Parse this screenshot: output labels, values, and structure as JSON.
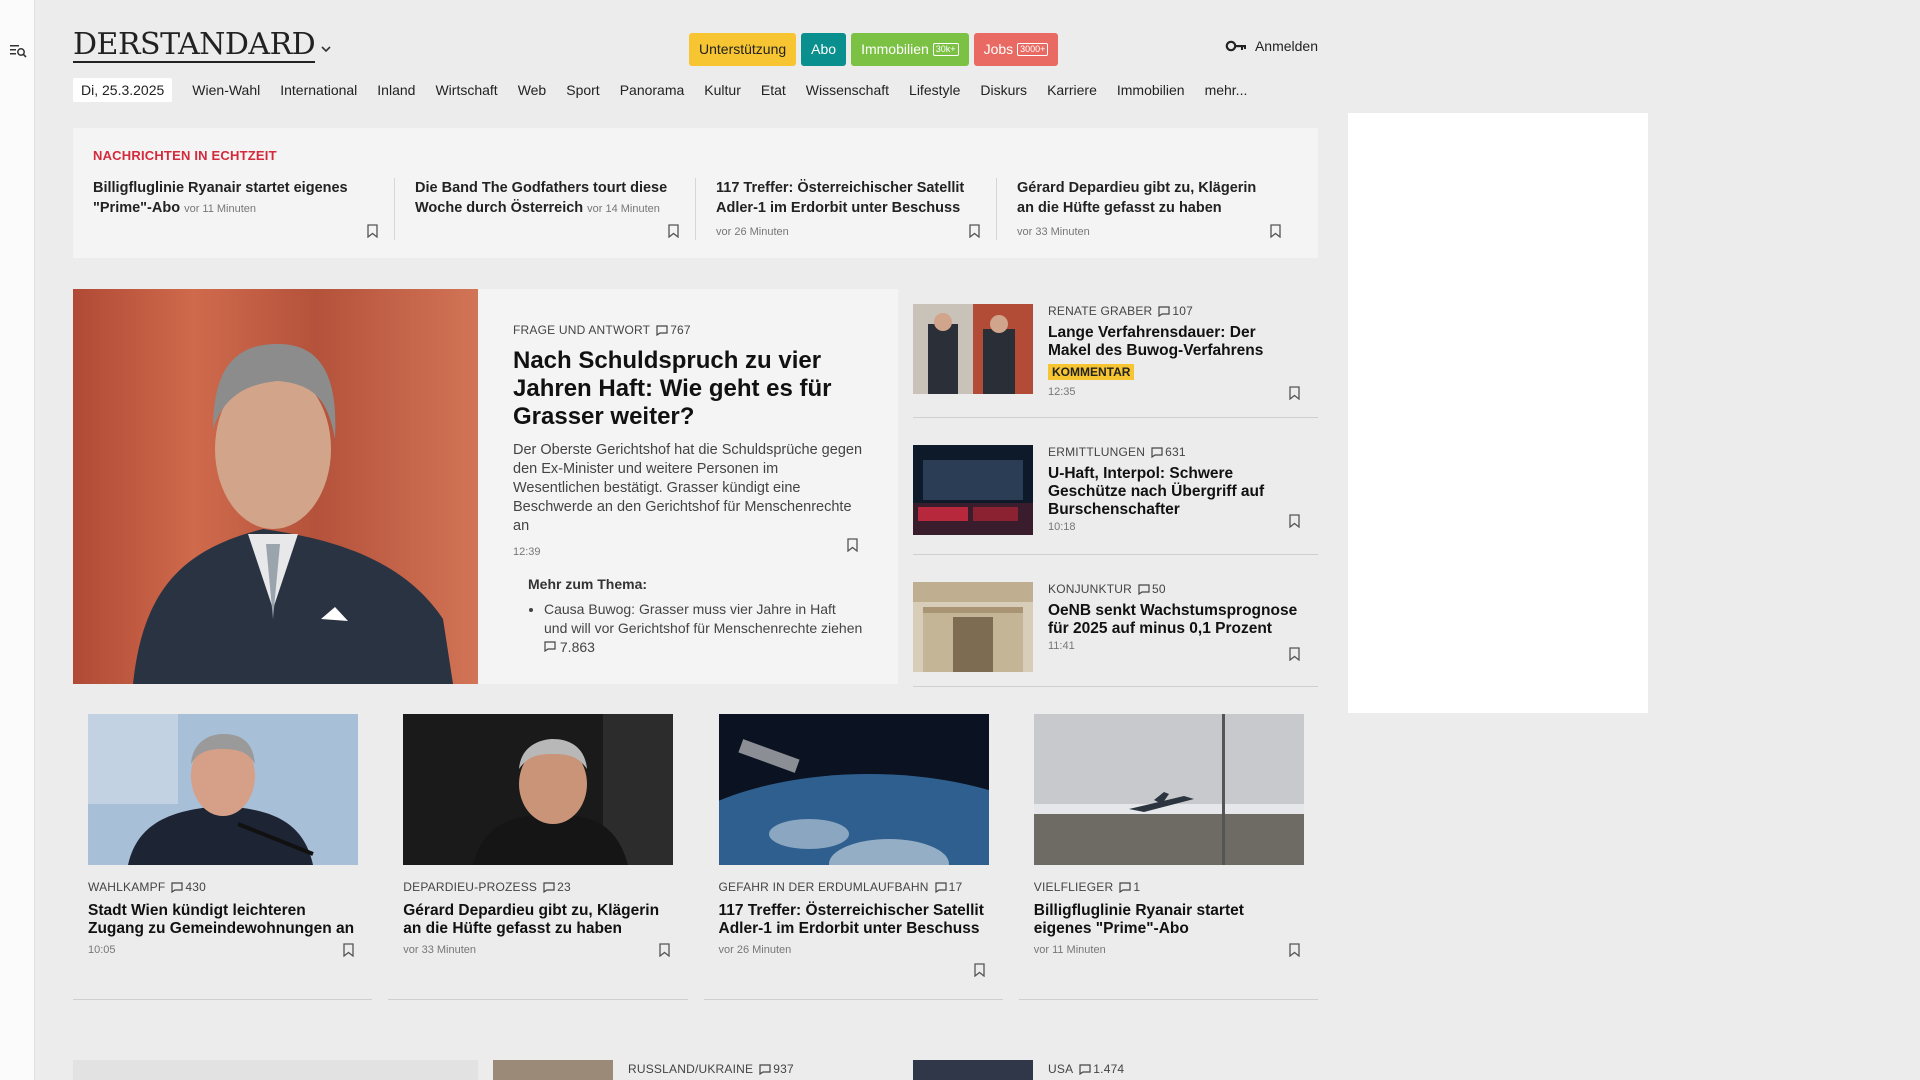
{
  "header": {
    "logo_text": "DERSTANDARD",
    "pills": [
      {
        "label": "Unterstützung",
        "tag": ""
      },
      {
        "label": "Abo",
        "tag": ""
      },
      {
        "label": "Immobilien",
        "tag": "30k+"
      },
      {
        "label": "Jobs",
        "tag": "3000+"
      }
    ],
    "login_label": "Anmelden"
  },
  "nav": {
    "date": "Di, 25.3.2025",
    "items": [
      "Wien-Wahl",
      "International",
      "Inland",
      "Wirtschaft",
      "Web",
      "Sport",
      "Panorama",
      "Kultur",
      "Etat",
      "Wissenschaft",
      "Lifestyle",
      "Diskurs",
      "Karriere",
      "Immobilien",
      "mehr..."
    ]
  },
  "live": {
    "heading": "NACHRICHTEN IN ECHTZEIT",
    "items": [
      {
        "title": "Billigfluglinie Ryanair startet eigenes \"Prime\"-Abo",
        "time": "vor 11 Minuten"
      },
      {
        "title": "Die Band The Godfathers tourt diese Woche durch Österreich",
        "time": "vor 14 Minuten"
      },
      {
        "title": "117 Treffer: Österreichischer Satellit Adler-1 im Erdorbit unter Beschuss",
        "time": "vor 26 Minuten"
      },
      {
        "title": "Gérard Depardieu gibt zu, Klägerin an die Hüfte gefasst zu haben",
        "time": "vor 33 Minuten"
      }
    ]
  },
  "lead": {
    "kicker": "FRAGE UND ANTWORT",
    "comments": "767",
    "title": "Nach Schuldspruch zu vier Jahren Haft: Wie geht es für Grasser weiter?",
    "teaser": "Der Oberste Gerichtshof hat die Schuldsprüche gegen den Ex-Minister und weitere Personen im Wesentlichen bestätigt. Grasser kündigt eine Beschwerde an den Gerichtshof für Menschenrechte an",
    "time": "12:39",
    "more_title": "Mehr zum Thema:",
    "more_item": "Causa Buwog: Grasser muss vier Jahre in Haft und will vor Gerichtshof für Menschenrechte ziehen",
    "more_comments": "7.863"
  },
  "side": [
    {
      "kicker": "RENATE GRABER",
      "comments": "107",
      "title": "Lange Verfahrensdauer: Der Makel des Buwog-Verfahrens",
      "badge": "KOMMENTAR",
      "time": "12:35"
    },
    {
      "kicker": "ERMITTLUNGEN",
      "comments": "631",
      "title": "U-Haft, Interpol: Schwere Geschütze nach Übergriff auf Burschenschafter",
      "badge": "",
      "time": "10:18"
    },
    {
      "kicker": "KONJUNKTUR",
      "comments": "50",
      "title": "OeNB senkt Wachstumsprognose für 2025 auf minus 0,1 Prozent",
      "badge": "",
      "time": "11:41"
    }
  ],
  "tiles": [
    {
      "kicker": "WAHLKAMPF",
      "comments": "430",
      "title": "Stadt Wien kündigt leichteren Zugang zu Gemeindewohnungen an",
      "time": "10:05"
    },
    {
      "kicker": "DEPARDIEU-PROZESS",
      "comments": "23",
      "title": "Gérard Depardieu gibt zu, Klägerin an die Hüfte gefasst zu haben",
      "time": "vor 33 Minuten"
    },
    {
      "kicker": "GEFAHR IN DER ERDUMLAUFBAHN",
      "comments": "17",
      "title": "117 Treffer: Österreichischer Satellit Adler-1 im Erdorbit unter Beschuss",
      "time": "vor 26 Minuten"
    },
    {
      "kicker": "VIELFLIEGER",
      "comments": "1",
      "title": "Billigfluglinie Ryanair startet eigenes \"Prime\"-Abo",
      "time": "vor 11 Minuten"
    }
  ],
  "bottom": [
    {
      "kicker": "RUSSLAND/UKRAINE",
      "comments": "937"
    },
    {
      "kicker": "USA",
      "comments": "1.474"
    }
  ]
}
